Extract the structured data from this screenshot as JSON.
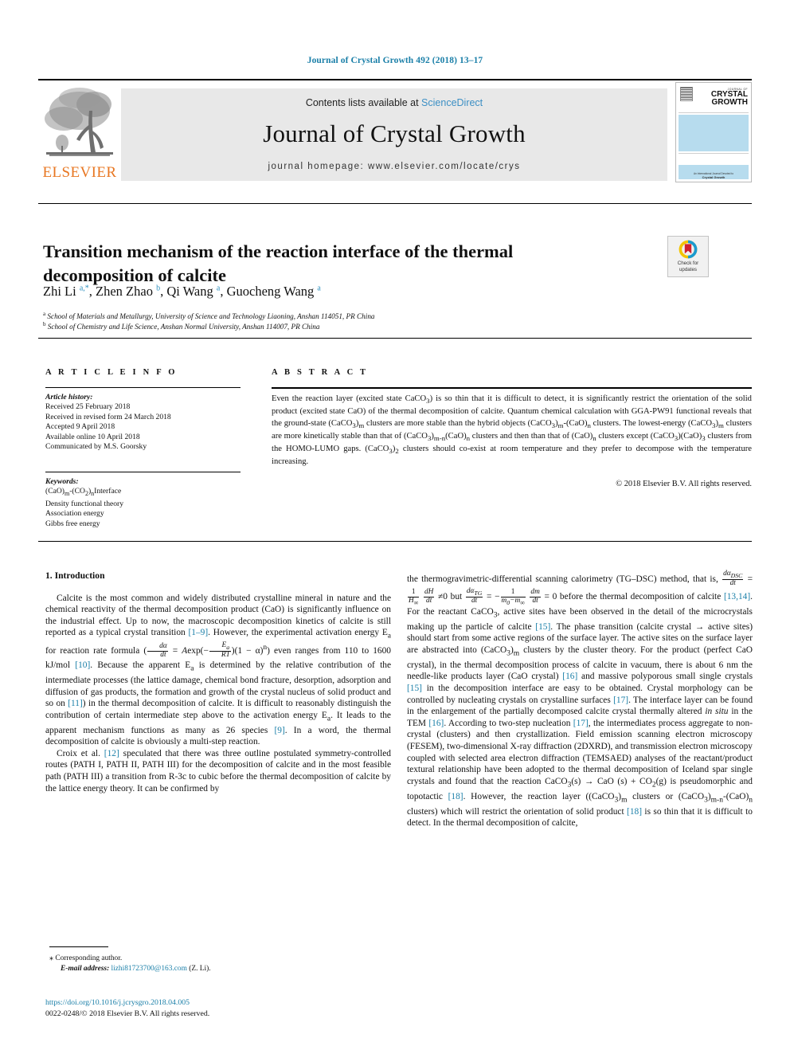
{
  "running_head": "Journal of Crystal Growth 492 (2018) 13–17",
  "masthead": {
    "publisher_name": "ELSEVIER",
    "contents_prefix": "Contents lists available at",
    "sciencedirect": "ScienceDirect",
    "journal_title": "Journal of Crystal Growth",
    "homepage": "journal homepage: www.elsevier.com/locate/crys",
    "cover": {
      "journal_of": "JOURNAL OF",
      "line1": "CRYSTAL",
      "line2": "GROWTH",
      "footer_small": "An International Journal Devoted to",
      "footer_bold": "Crystal Growth"
    }
  },
  "article": {
    "title": "Transition mechanism of the reaction interface of the thermal decomposition of calcite",
    "authors_html": "Zhi Li <sup>a,*</sup>, Zhen Zhao <sup>b</sup>, Qi Wang <sup>a</sup>, Guocheng Wang <sup>a</sup>",
    "affiliation_a": "School of Materials and Metallurgy, University of Science and Technology Liaoning, Anshan 114051, PR China",
    "affiliation_b": "School of Chemistry and Life Science, Anshan Normal University, Anshan 114007, PR China",
    "crossmark_line1": "Check for",
    "crossmark_line2": "updates"
  },
  "info": {
    "heading": "A R T I C L E   I N F O",
    "history_label": "Article history:",
    "history": [
      "Received 25 February 2018",
      "Received in revised form 24 March 2018",
      "Accepted 9 April 2018",
      "Available online 10 April 2018",
      "Communicated by M.S. Goorsky"
    ],
    "keywords_label": "Keywords:",
    "keywords": [
      "(CaO)m-(CO2)nInterface",
      "Density functional theory",
      "Association energy",
      "Gibbs free energy"
    ]
  },
  "abstract": {
    "heading": "A B S T R A C T",
    "text": "Even the reaction layer (excited state CaCO3) is so thin that it is difficult to detect, it is significantly restrict the orientation of the solid product (excited state CaO) of the thermal decomposition of calcite. Quantum chemical calculation with GGA-PW91 functional reveals that the ground-state (CaCO3)m clusters are more stable than the hybrid objects (CaCO3)m-(CaO)n clusters. The lowest-energy (CaCO3)m clusters are more kinetically stable than that of (CaCO3)m-n(CaO)n clusters and then than that of (CaO)n clusters except (CaCO3)(CaO)3 clusters from the HOMO-LUMO gaps. (CaCO3)2 clusters should co-exist at room temperature and they prefer to decompose with the temperature increasing.",
    "copyright": "© 2018 Elsevier B.V. All rights reserved."
  },
  "body": {
    "section_number_title": "1. Introduction",
    "left_paragraph_1_pre": "Calcite is the most common and widely distributed crystalline mineral in nature and the chemical reactivity of the thermal decomposition product (CaO) is significantly influence on the industrial effect. Up to now, the macroscopic decomposition kinetics of calcite is still reported as a typical crystal transition ",
    "ref_1_9": "[1–9]",
    "left_p1_mid": ". However, the experimental activation energy E",
    "left_p1_mid2": " for reaction rate formula (",
    "left_p1_after_formula": ") even ranges from 110 to 1600 kJ/mol ",
    "ref_10": "[10]",
    "left_p1_tail": ". Because the apparent E",
    "left_p1_tail2": " is determined by the relative contribution of the intermediate processes (the lattice damage, chemical bond fracture, desorption, adsorption and diffusion of gas products, the formation and growth of the crystal nucleus of solid product and so on ",
    "ref_11": "[11]",
    "left_p1_tail3": ") in the thermal decomposition of calcite. It is difficult to reasonably distinguish the contribution of certain intermediate step above to the activation energy E",
    "left_p1_tail4": ". It leads to the apparent mechanism functions as many as 26 species ",
    "ref_9": "[9]",
    "left_p1_tail5": ". In a word, the thermal decomposition of calcite is obviously a multi-step reaction.",
    "left_p2_pre": "Croix et al. ",
    "ref_12": "[12]",
    "left_p2_post": " speculated that there was three outline postulated symmetry-controlled routes (PATH I, PATH II, PATH III) for the decomposition of calcite and in the most feasible path (PATH III) a transition from R-3c to cubic before the thermal decomposition of calcite by the lattice energy theory. It can be confirmed by",
    "right_p1_pre": "the thermogravimetric-differential scanning calorimetry (TG–DSC) method, that is, ",
    "right_p1_mid": " before the thermal decomposition of calcite ",
    "ref_13_14": "[13,14]",
    "right_p1_a": ". For the reactant CaCO3, active sites have been observed in the detail of the microcrystals making up the particle of calcite ",
    "ref_15": "[15]",
    "right_p1_b": ". The phase transition (calcite crystal → active sites) should start from some active regions of the surface layer. The active sites on the surface layer are abstracted into (CaCO3)m clusters by the cluster theory. For the product (perfect CaO crystal), in the thermal decomposition process of calcite in vacuum, there is about 6 nm the needle-like products layer (CaO crystal) ",
    "ref_16": "[16]",
    "right_p1_c": " and massive polyporous small single crystals ",
    "ref_15b": "[15]",
    "right_p1_d": " in the decomposition interface are easy to be obtained. Crystal morphology can be controlled by nucleating crystals on crystalline surfaces ",
    "ref_17": "[17]",
    "right_p1_e": ". The interface layer can be found in the enlargement of the partially decomposed calcite crystal thermally altered in situ in the TEM ",
    "ref_16b": "[16]",
    "right_p1_f": ". According to two-step nucleation ",
    "ref_17b": "[17]",
    "right_p1_g": ", the intermediates process aggregate to non-crystal (clusters) and then crystallization. Field emission scanning electron microscopy (FESEM), two-dimensional X-ray diffraction (2DXRD), and transmission electron microscopy coupled with selected area electron diffraction (TEMSAED) analyses of the reactant/product textural relationship have been adopted to the thermal decomposition of Iceland spar single crystals and found that the reaction CaCO3(s) → CaO (s) + CO2(g) is pseudomorphic and topotactic ",
    "ref_18": "[18]",
    "right_p1_h": ". However, the reaction layer ((CaCO3)m clusters or (CaCO3)m-n-(CaO)n clusters) which will restrict the orientation of solid product ",
    "ref_18b": "[18]",
    "right_p1_i": " is so thin that it is difficult to detect. In the thermal decomposition of calcite,"
  },
  "footer": {
    "corresponding_star": "⁎",
    "corresponding_label": "Corresponding author.",
    "email_label": "E-mail address:",
    "email": "lizhi81723700@163.com",
    "email_suffix": "(Z. Li).",
    "doi": "https://doi.org/10.1016/j.jcrysgro.2018.04.005",
    "issn_line": "0022-0248/© 2018 Elsevier B.V. All rights reserved."
  },
  "colors": {
    "link": "#1a7fa8",
    "elsevier_orange": "#E87722",
    "cover_blue": "#b7dcee",
    "band_gray": "#e8e8e8"
  }
}
